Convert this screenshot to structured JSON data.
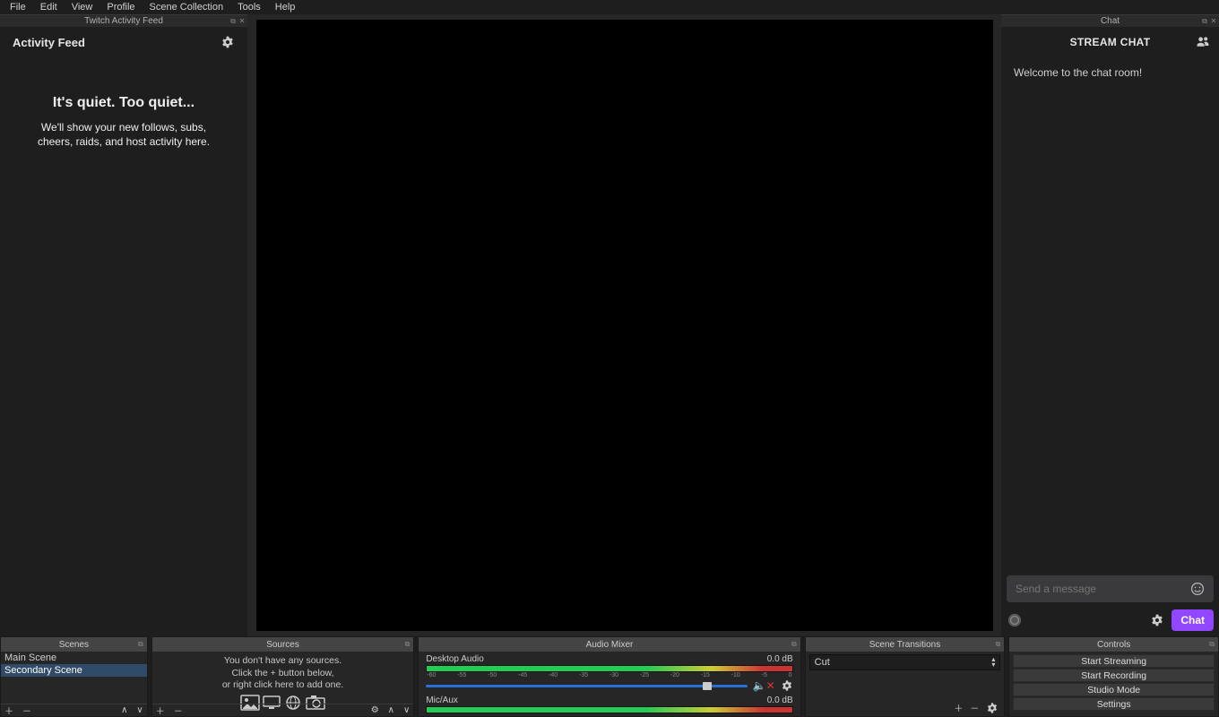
{
  "menubar": [
    "File",
    "Edit",
    "View",
    "Profile",
    "Scene Collection",
    "Tools",
    "Help"
  ],
  "activity_feed": {
    "panel_title": "Twitch Activity Feed",
    "header": "Activity Feed",
    "headline": "It's quiet. Too quiet...",
    "sub1": "We'll show your new follows, subs,",
    "sub2": "cheers, raids, and host activity here."
  },
  "chat": {
    "panel_title": "Chat",
    "header": "STREAM CHAT",
    "welcome": "Welcome to the chat room!",
    "placeholder": "Send a message",
    "send_label": "Chat"
  },
  "docks": {
    "scenes_title": "Scenes",
    "sources_title": "Sources",
    "mixer_title": "Audio Mixer",
    "transitions_title": "Scene Transitions",
    "controls_title": "Controls"
  },
  "scenes": [
    "Main Scene",
    "Secondary Scene"
  ],
  "scene_selected_index": 1,
  "sources_empty": {
    "l1": "You don't have any sources.",
    "l2": "Click the + button below,",
    "l3": "or right click here to add one."
  },
  "mixer": {
    "ch1_name": "Desktop Audio",
    "ch1_db": "0.0 dB",
    "ch2_name": "Mic/Aux",
    "ch2_db": "0.0 dB",
    "ticks": [
      "-60",
      "-55",
      "-50",
      "-45",
      "-40",
      "-35",
      "-30",
      "-25",
      "-20",
      "-15",
      "-10",
      "-5",
      "0"
    ]
  },
  "transitions": {
    "selected": "Cut"
  },
  "controls": [
    "Start Streaming",
    "Start Recording",
    "Studio Mode",
    "Settings"
  ]
}
